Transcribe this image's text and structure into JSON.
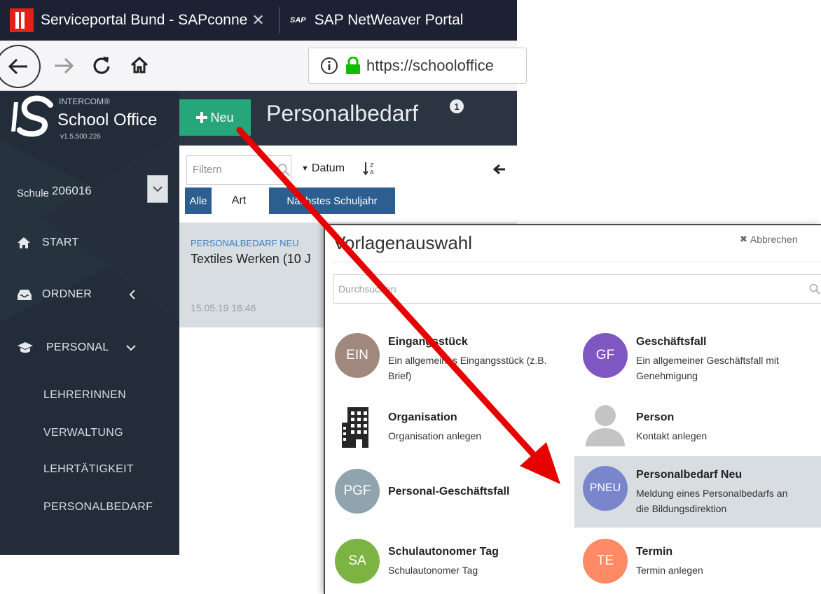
{
  "browser": {
    "tabs": [
      {
        "title": "Serviceportal Bund - SAPconne",
        "close": "✕"
      },
      {
        "title": "SAP NetWeaver Portal",
        "logo": "SAP"
      }
    ],
    "url": "https://schooloffice"
  },
  "app": {
    "brand_small": "INTERCOM®",
    "brand_name": "School Office",
    "version": "v1.5.500.226"
  },
  "sidebar": {
    "school_label": "Schule",
    "school_value": "206016",
    "nav": [
      {
        "label": "Start"
      },
      {
        "label": "Ordner"
      },
      {
        "label": "Personal"
      }
    ],
    "sub_items": [
      {
        "label": "LehrerInnen"
      },
      {
        "label": "Verwaltung"
      },
      {
        "label": "Lehrtätigkeit"
      },
      {
        "label": "Personalbedarf"
      }
    ]
  },
  "header": {
    "new_button": "Neu",
    "title": "Personalbedarf",
    "badge": "1"
  },
  "list": {
    "filter_placeholder": "Filtern",
    "sort_label": "Datum",
    "chips": [
      "Alle",
      "Art",
      "Nächstes Schuljahr"
    ],
    "items": [
      {
        "type": "PERSONALBEDARF NEU",
        "title": "Textiles Werken (10 J",
        "date": "15.05.19 16:46"
      }
    ]
  },
  "modal": {
    "title": "Vorlagenauswahl",
    "cancel": "Abbrechen",
    "search_placeholder": "Durchsuchen",
    "templates": [
      {
        "abbr": "EIN",
        "color": "#a1887f",
        "name": "Eingangsstück",
        "desc_lines": [
          "Ein allgemeines Eingangsstück (z.B.",
          "Brief)"
        ]
      },
      {
        "abbr": "GF",
        "color": "#7e57c2",
        "name": "Geschäftsfall",
        "desc_lines": [
          "Ein allgemeiner Geschäftsfall mit",
          "Genehmigung"
        ]
      },
      {
        "icon": "building-icon",
        "name": "Organisation",
        "desc_lines": [
          "Organisation anlegen"
        ]
      },
      {
        "icon": "person-silhouette-icon",
        "name": "Person",
        "desc_lines": [
          "Kontakt anlegen"
        ]
      },
      {
        "abbr": "PGF",
        "color": "#90a4ae",
        "name": "Personal-Geschäftsfall",
        "desc_lines": []
      },
      {
        "abbr": "PNEU",
        "color": "#7986cb",
        "name": "Personalbedarf Neu",
        "desc_lines": [
          "Meldung eines Personalbedarfs an",
          "die Bildungsdirektion"
        ],
        "selected": true
      },
      {
        "abbr": "SA",
        "color": "#7cb342",
        "name": "Schulautonomer Tag",
        "desc_lines": [
          "Schulautonomer Tag"
        ]
      },
      {
        "abbr": "TE",
        "color": "#ff8a65",
        "name": "Termin",
        "desc_lines": [
          "Termin anlegen"
        ]
      }
    ]
  },
  "annotation": {
    "arrow_color": "#e60000"
  }
}
